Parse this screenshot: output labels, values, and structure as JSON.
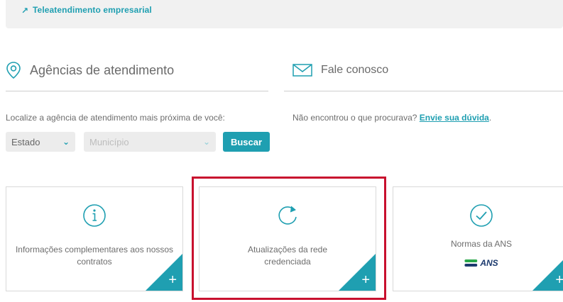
{
  "topbar": {
    "label": "Teleatendimento empresarial",
    "arrow": "↗"
  },
  "agencias": {
    "title": "Agências de atendimento",
    "icon": "location-pin-icon",
    "help": "Localize a agência de atendimento mais próxima de você:",
    "estado": {
      "value": "Estado"
    },
    "municipio": {
      "placeholder": "Município"
    },
    "buscar_label": "Buscar"
  },
  "fale": {
    "title": "Fale conosco",
    "icon": "envelope-icon",
    "help_prefix": "Não encontrou o que procurava?",
    "help_link": "Envie sua dúvida",
    "help_suffix": "."
  },
  "cards": [
    {
      "icon": "info-icon",
      "text": "Informações complementares aos nossos contratos"
    },
    {
      "icon": "refresh-icon",
      "text": "Atualizações da rede credenciada"
    },
    {
      "icon": "check-circle-icon",
      "text": "Normas da ANS",
      "logo_text": "ANS"
    }
  ],
  "plus_glyph": "+",
  "colors": {
    "accent": "#1f9fb1",
    "highlight": "#c8102e",
    "topbar_bg": "#f1f1f1",
    "select_bg": "#ececec"
  }
}
